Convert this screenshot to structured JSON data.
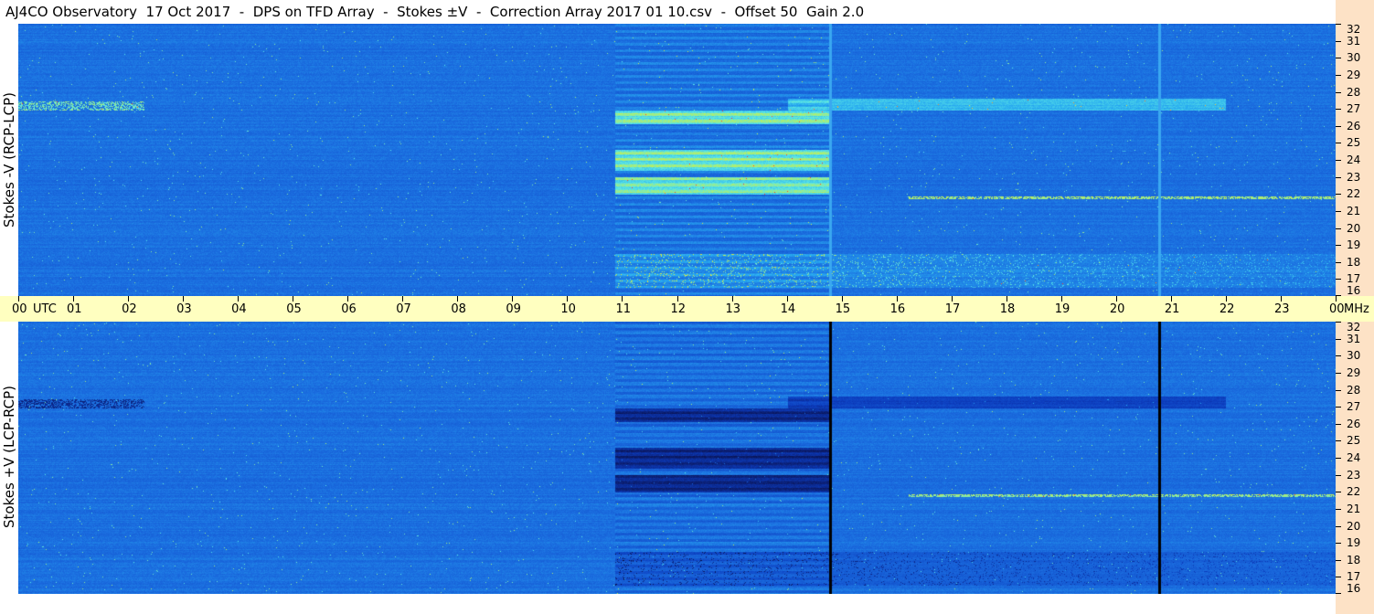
{
  "title": "AJ4CO Observatory  17 Oct 2017  -  DPS on TFD Array  -  Stokes ±V  -  Correction Array 2017 01 10.csv  -  Offset 50  Gain 2.0",
  "chart_data": {
    "type": "heatmap",
    "panels": [
      {
        "name": "top",
        "ylabel": "Stokes -V (RCP-LCP)"
      },
      {
        "name": "bottom",
        "ylabel": "Stokes +V (LCP-RCP)"
      }
    ],
    "time_axis": {
      "labels": [
        "00",
        "01",
        "02",
        "03",
        "04",
        "05",
        "06",
        "07",
        "08",
        "09",
        "10",
        "11",
        "12",
        "13",
        "14",
        "15",
        "16",
        "17",
        "18",
        "19",
        "20",
        "21",
        "22",
        "23",
        "00"
      ],
      "unit": "UTC",
      "range_hours": [
        0,
        24
      ]
    },
    "freq_axis": {
      "labels": [
        "32",
        "31",
        "30",
        "29",
        "28",
        "27",
        "26",
        "25",
        "24",
        "23",
        "22",
        "21",
        "20",
        "19",
        "18",
        "17",
        "16"
      ],
      "unit": "MHz",
      "range_mhz": [
        16,
        32
      ]
    },
    "colors": {
      "background": "#1b6ee0",
      "axis_time_bg": "#ffffc0",
      "axis_freq_bg": "#fde2c6"
    }
  }
}
